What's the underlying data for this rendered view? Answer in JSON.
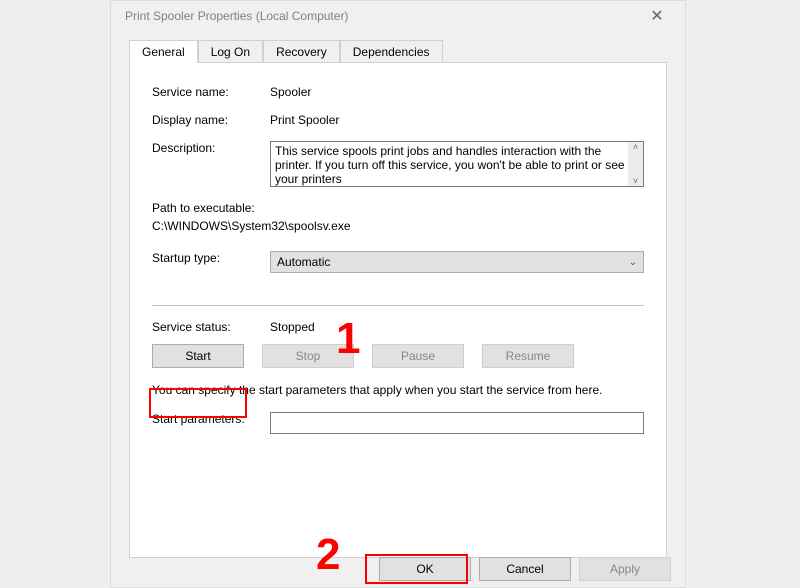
{
  "title": "Print Spooler Properties (Local Computer)",
  "tabs": {
    "general": "General",
    "logon": "Log On",
    "recovery": "Recovery",
    "dependencies": "Dependencies"
  },
  "labels": {
    "service_name": "Service name:",
    "display_name": "Display name:",
    "description": "Description:",
    "path_to_exe": "Path to executable:",
    "startup_type": "Startup type:",
    "service_status": "Service status:",
    "start_parameters": "Start parameters:"
  },
  "values": {
    "service_name": "Spooler",
    "display_name": "Print Spooler",
    "description": "This service spools print jobs and handles interaction with the printer.  If you turn off this service, you won't be able to print or see your printers",
    "path": "C:\\WINDOWS\\System32\\spoolsv.exe",
    "startup_type": "Automatic",
    "service_status": "Stopped",
    "start_parameters": ""
  },
  "help_text": "You can specify the start parameters that apply when you start the service from here.",
  "buttons": {
    "start": "Start",
    "stop": "Stop",
    "pause": "Pause",
    "resume": "Resume",
    "ok": "OK",
    "cancel": "Cancel",
    "apply": "Apply"
  },
  "annotations": {
    "one": "1",
    "two": "2"
  }
}
